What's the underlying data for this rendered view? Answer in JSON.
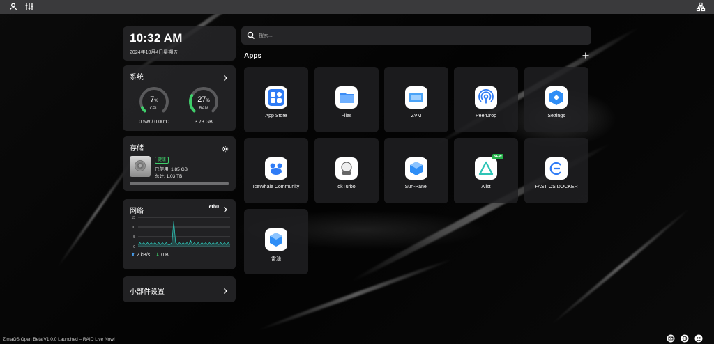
{
  "topbar": {
    "left_icons": [
      "user-icon",
      "sliders-icon"
    ],
    "right_icon": "network-icon"
  },
  "clock": {
    "time": "10:32 AM",
    "date": "2024年10月4日星期五"
  },
  "system": {
    "title": "系统",
    "cpu": {
      "value": "7",
      "unit": "%",
      "label": "CPU",
      "percent": 7,
      "sub": "0.5W / 0.00°C"
    },
    "ram": {
      "value": "27",
      "unit": "%",
      "label": "RAM",
      "percent": 27,
      "sub": "3.73 GB"
    },
    "accent": "#3ecf6a"
  },
  "storage": {
    "title": "存储",
    "status_badge": "健康",
    "used": "已使用: 1.85 GB",
    "total": "总计: 1.03 TB",
    "used_fraction": 0.002
  },
  "network": {
    "title": "网络",
    "interface": "eth0",
    "upload": "2 kB/s",
    "download": "0 B",
    "chart_data": {
      "type": "line",
      "title": "",
      "xlabel": "",
      "ylabel": "",
      "ylim": [
        0,
        15
      ],
      "yticks": [
        0,
        5,
        10,
        15
      ],
      "grid": true,
      "series": [
        {
          "values": [
            1,
            2,
            1,
            2,
            1,
            2,
            1,
            2,
            1,
            2,
            1,
            2,
            1,
            2,
            1,
            2,
            1,
            1,
            2,
            13,
            2,
            1,
            2,
            1,
            2,
            1,
            2,
            1,
            3,
            1,
            2,
            1,
            2,
            1,
            2,
            1,
            2,
            1,
            2,
            1,
            2,
            1,
            2,
            1,
            2,
            1,
            2,
            1,
            2,
            1
          ]
        }
      ],
      "color": "#2ec4b6"
    }
  },
  "widgets": {
    "title": "小部件设置"
  },
  "search": {
    "placeholder": "搜索..."
  },
  "apps": {
    "title": "Apps",
    "items": [
      {
        "label": "App Store",
        "icon": "app-store-icon",
        "color": "#2f7cf6"
      },
      {
        "label": "Files",
        "icon": "folder-icon",
        "color": "#3b8cf5"
      },
      {
        "label": "ZVM",
        "icon": "zvm-icon",
        "color": "#4aa3f7"
      },
      {
        "label": "PeerDrop",
        "icon": "peerdrop-icon",
        "color": "#2f7cf6"
      },
      {
        "label": "Settings",
        "icon": "settings-icon",
        "color": "#2f8ef6"
      },
      {
        "label": "IceWhale Community",
        "icon": "community-icon",
        "color": "#2f7cf6"
      },
      {
        "label": "dkTurbo",
        "icon": "dkturbo-icon",
        "color": "#666666"
      },
      {
        "label": "Sun-Panel",
        "icon": "cube-icon",
        "color": "#2f8ef6"
      },
      {
        "label": "Alist",
        "icon": "alist-icon",
        "color": "#2ec4b6",
        "badge": "NEW"
      },
      {
        "label": "FAST OS DOCKER",
        "icon": "fast-os-icon",
        "color": "#2f7cf6"
      },
      {
        "label": "雷池",
        "icon": "cube-icon",
        "color": "#2f8ef6"
      }
    ]
  },
  "footer": {
    "announcement": "ZimaOS Open Beta V1.0.0 Launched – RAID Live Now!",
    "icons": [
      "mail-icon",
      "chat-icon",
      "community-icon"
    ]
  }
}
